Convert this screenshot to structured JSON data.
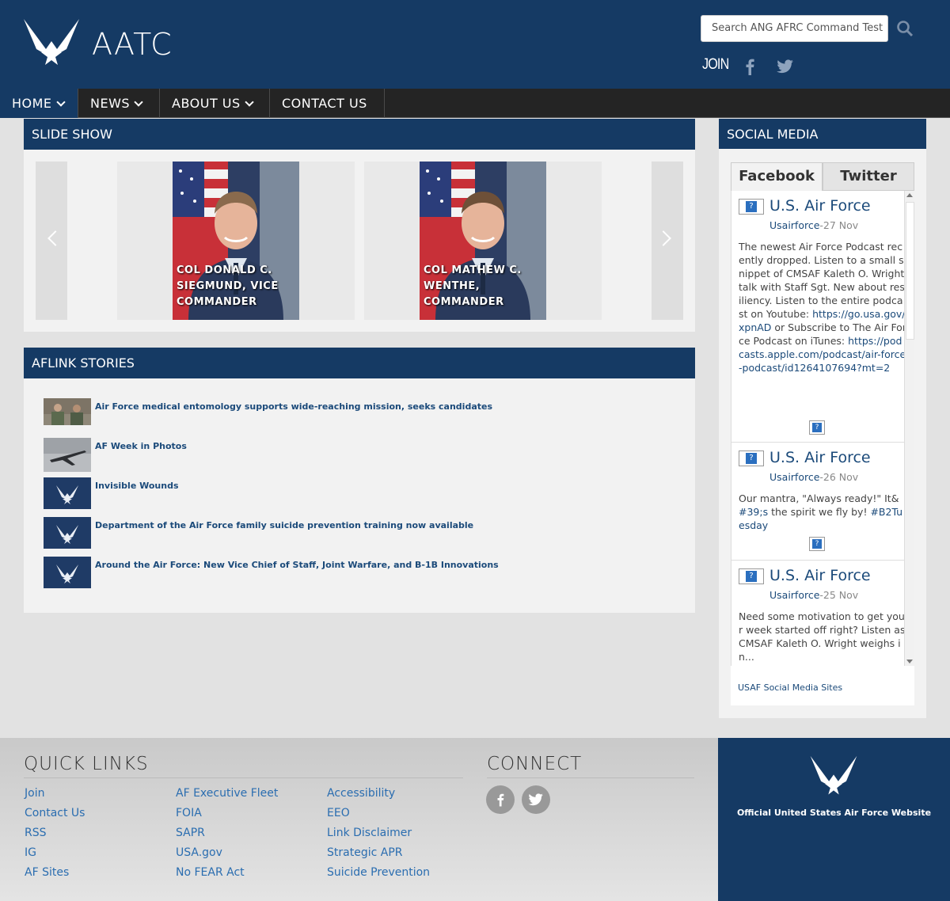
{
  "header": {
    "site_title": "AATC",
    "search_placeholder": "Search ANG AFRC Command Test",
    "join_label": "JOIN"
  },
  "nav": [
    {
      "label": "HOME",
      "dropdown": true,
      "active": true
    },
    {
      "label": "NEWS",
      "dropdown": true,
      "active": false
    },
    {
      "label": "ABOUT US",
      "dropdown": true,
      "active": false
    },
    {
      "label": "CONTACT US",
      "dropdown": false,
      "active": false
    }
  ],
  "slideshow": {
    "heading": "SLIDE SHOW",
    "slides": [
      {
        "caption": "COL DONALD C. SIEGMUND, VICE COMMANDER"
      },
      {
        "caption": "COL MATHEW C. WENTHE, COMMANDER"
      }
    ]
  },
  "stories": {
    "heading": "AFLINK STORIES",
    "items": [
      {
        "title": "Air Force medical entomology supports wide-reaching mission, seeks candidates",
        "thumb": "lab-photo"
      },
      {
        "title": "AF Week in Photos",
        "thumb": "aircraft-photo"
      },
      {
        "title": "Invisible Wounds",
        "thumb": "af-symbol"
      },
      {
        "title": "Department of the Air Force family suicide prevention training now available",
        "thumb": "af-symbol"
      },
      {
        "title": "Around the Air Force: New Vice Chief of Staff, Joint Warfare, and B-1B Innovations",
        "thumb": "af-symbol"
      }
    ]
  },
  "social": {
    "heading": "SOCIAL MEDIA",
    "tabs": [
      "Facebook",
      "Twitter"
    ],
    "posts": [
      {
        "name": "U.S. Air Force",
        "handle": "Usairforce",
        "date": "-27 Nov",
        "text_before": "The newest Air Force Podcast recently dropped. Listen to a small snippet of CMSAF Kaleth O. Wright talk with Staff Sgt. New about resiliency. Listen to the entire podcast on Youtube: ",
        "link1": "https://go.usa.gov/xpnAD",
        "text_mid": " or Subscribe to The Air Force Podcast on iTunes: ",
        "link2": "https://podcasts.apple.com/podcast/air-force-podcast/id1264107694?mt=2"
      },
      {
        "name": "U.S. Air Force",
        "handle": "Usairforce",
        "date": "-26 Nov",
        "text_before": "Our mantra, \"Always ready!\" It&",
        "link1": "#39;s",
        "text_mid": " the spirit we fly by! ",
        "link2": "#B2Tuesday"
      },
      {
        "name": "U.S. Air Force",
        "handle": "Usairforce",
        "date": "-25 Nov",
        "text_before": "Need some motivation to get your week started off right? Listen as CMSAF Kaleth O. Wright weighs in...",
        "link1": "",
        "text_mid": "",
        "link2": ""
      }
    ],
    "footer_link": "USAF Social Media Sites"
  },
  "footer": {
    "quick_links_title": "QUICK LINKS",
    "connect_title": "CONNECT",
    "columns": [
      [
        "Join",
        "Contact Us",
        "RSS",
        "IG",
        "AF Sites"
      ],
      [
        "AF Executive Fleet",
        "FOIA",
        "SAPR",
        "USA.gov",
        "No FEAR Act"
      ],
      [
        "Accessibility",
        "EEO",
        "Link Disclaimer",
        "Strategic APR",
        "Suicide Prevention"
      ]
    ],
    "af_text": "Official United States Air Force Website"
  },
  "colors": {
    "brand_navy": "#153a64",
    "nav_dark": "#242424",
    "link_blue": "#2a6db0"
  },
  "icons": [
    "af-logo-icon",
    "search-icon",
    "facebook-icon",
    "twitter-icon",
    "chevron-down-icon",
    "chevron-left-icon",
    "chevron-right-icon"
  ]
}
